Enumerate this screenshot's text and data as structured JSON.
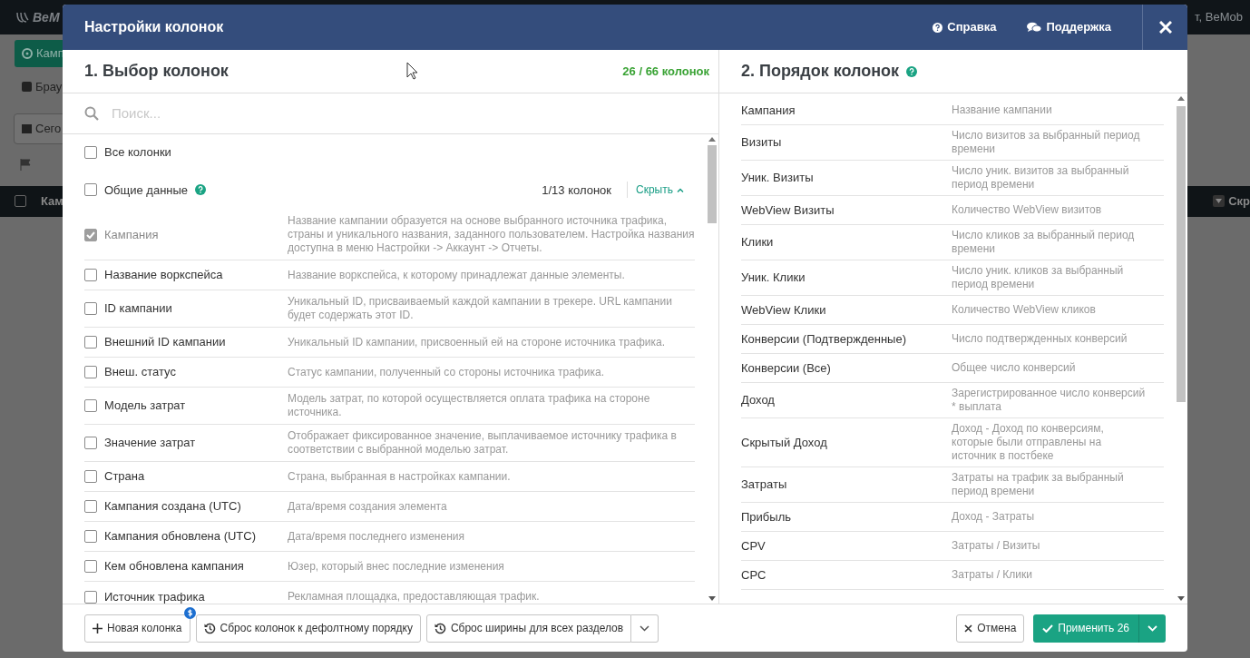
{
  "background": {
    "logo": "BeM",
    "user": "т, BeMob",
    "nav_button": "Камп",
    "nav_link": "Брау",
    "date_button": "Сего",
    "header_checkbox": {
      "checked": false
    },
    "table_header": [
      "Кам",
      "Скр"
    ]
  },
  "modal": {
    "title": "Настройки колонок",
    "header_links": [
      {
        "label": "Справка",
        "kind": "help"
      },
      {
        "label": "Поддержка",
        "kind": "chat"
      }
    ]
  },
  "selection": {
    "title": "1. Выбор колонок",
    "count": "26 / 66 колонок",
    "search": {
      "placeholder": "Поиск..."
    },
    "all": {
      "label": "Все колонки",
      "checked": false
    },
    "groups": [
      {
        "label": "Общие данные",
        "checked": false,
        "count": "1/13 колонок",
        "toggle": "Скрыть",
        "expanded": true,
        "items": [
          {
            "label": "Кампания",
            "description": "Название кампании образуется на основе выбранного источника трафика, страны и уникального названия, заданного пользователем. Настройка названия доступна в меню Настройки -> Аккаунт -> Отчеты.",
            "checked": true,
            "disabled": true
          },
          {
            "label": "Название воркспейса",
            "description": "Название воркспейса, к которому принадлежат данные элементы.",
            "checked": false,
            "disabled": false
          },
          {
            "label": "ID кампании",
            "description": "Уникальный ID, присваиваемый каждой кампании в трекере. URL кампании будет содержать этот ID.",
            "checked": false,
            "disabled": false
          },
          {
            "label": "Внешний ID кампании",
            "description": "Уникальный ID кампании, присвоенный ей на стороне источника трафика.",
            "checked": false,
            "disabled": false
          },
          {
            "label": "Внеш. статус",
            "description": "Статус кампании, полученный со стороны источника трафика.",
            "checked": false,
            "disabled": false
          },
          {
            "label": "Модель затрат",
            "description": "Модель затрат, по которой осуществляется оплата трафика на стороне источника.",
            "checked": false,
            "disabled": false
          },
          {
            "label": "Значение затрат",
            "description": "Отображает фиксированное значение, выплачиваемое источнику трафика в соответствии с выбранной моделью затрат.",
            "checked": false,
            "disabled": false
          },
          {
            "label": "Страна",
            "description": "Страна, выбранная в настройках кампании.",
            "checked": false,
            "disabled": false
          },
          {
            "label": "Кампания создана (UTC)",
            "description": "Дата/время создания элемента",
            "checked": false,
            "disabled": false
          },
          {
            "label": "Кампания обновлена (UTC)",
            "description": "Дата/время последнего изменения",
            "checked": false,
            "disabled": false
          },
          {
            "label": "Кем обновлена кампания",
            "description": "Юзер, который внес последние изменения",
            "checked": false,
            "disabled": false
          },
          {
            "label": "Источник трафика",
            "description": "Рекламная площадка, предоставляющая трафик.",
            "checked": false,
            "disabled": false
          }
        ]
      }
    ]
  },
  "order": {
    "title": "2. Порядок колонок",
    "items": [
      {
        "label": "Кампания",
        "description": "Название кампании"
      },
      {
        "label": "Визиты",
        "description": "Число визитов за выбранный период времени"
      },
      {
        "label": "Уник. Визиты",
        "description": "Число уник. визитов за выбранный период времени"
      },
      {
        "label": "WebView Визиты",
        "description": "Количество WebView визитов"
      },
      {
        "label": "Клики",
        "description": "Число кликов за выбранный период времени"
      },
      {
        "label": "Уник. Клики",
        "description": "Число уник. кликов за выбранный период времени"
      },
      {
        "label": "WebView Клики",
        "description": "Количество WebView кликов"
      },
      {
        "label": "Конверсии (Подтвержденные)",
        "description": "Число подтвержденных конверсий"
      },
      {
        "label": "Конверсии (Все)",
        "description": "Общее число конверсий"
      },
      {
        "label": "Доход",
        "description": "Зарегистрированное число конверсий * выплата"
      },
      {
        "label": "Скрытый Доход",
        "description": "Доход - Доход по конверсиям, которые были отправлены на источник в постбеке"
      },
      {
        "label": "Затраты",
        "description": "Затраты на трафик за выбранный период времени"
      },
      {
        "label": "Прибыль",
        "description": "Доход - Затраты"
      },
      {
        "label": "CPV",
        "description": "Затраты / Визиты"
      },
      {
        "label": "CPC",
        "description": "Затраты / Клики"
      }
    ]
  },
  "footer": {
    "left_buttons": [
      {
        "label": "Новая колонка",
        "kind": "add",
        "badge": true,
        "dropdown": false
      },
      {
        "label": "Сброс колонок к дефолтному порядку",
        "kind": "reset",
        "badge": false,
        "dropdown": false
      },
      {
        "label": "Сброс ширины для всех разделов",
        "kind": "reset",
        "badge": false,
        "dropdown": true
      }
    ],
    "cancel": "Отмена",
    "apply": "Применить 26"
  }
}
